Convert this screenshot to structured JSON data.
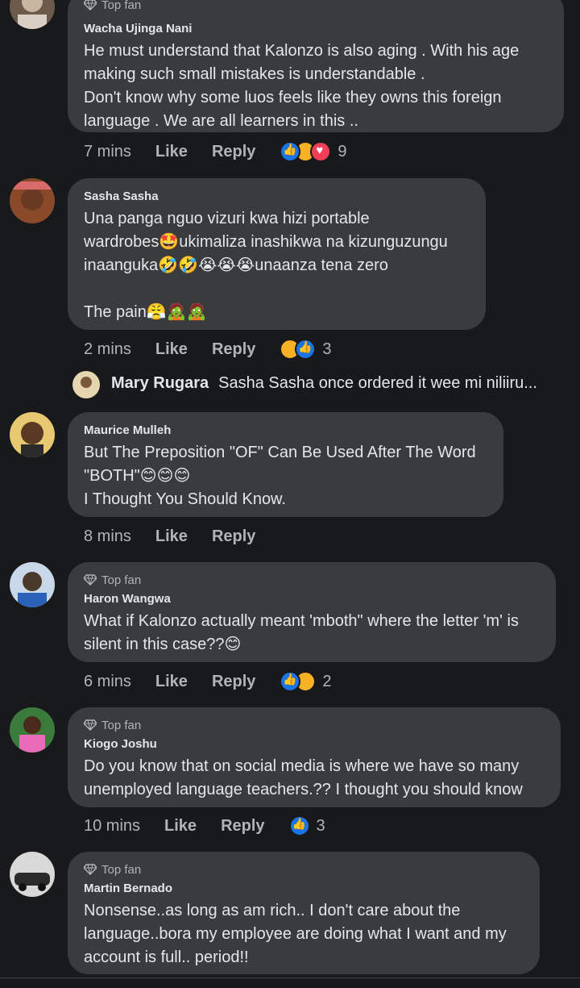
{
  "top_fan_label": "Top fan",
  "like_label": "Like",
  "reply_label": "Reply",
  "comments": [
    {
      "author": "Wacha Ujinga Nani",
      "top_fan": true,
      "text": "He must understand that Kalonzo is also aging  .  With his age\nmaking such small mistakes is understandable .\nDon't know why some luos feels like they owns this foreign\nlanguage . We are all learners in this ..",
      "time": "7 mins",
      "reactions": [
        "like",
        "haha",
        "love"
      ],
      "reaction_count": "9"
    },
    {
      "author": "Sasha Sasha",
      "top_fan": false,
      "text": "Una panga nguo vizuri kwa hizi portable\nwardrobes🤩ukimaliza inashikwa na kizunguzungu\ninaanguka🤣🤣😭😭😭unaanza tena zero\n\nThe pain😤🧟🧟",
      "time": "2 mins",
      "reactions": [
        "haha",
        "like"
      ],
      "reaction_count": "3",
      "reply": {
        "author": "Mary Rugara",
        "snippet": "Sasha Sasha once ordered it wee mi niliiru..."
      }
    },
    {
      "author": "Maurice Mulleh",
      "top_fan": false,
      "text": "But The Preposition \"OF\" Can Be Used After The Word\n\"BOTH\"😊😊😊\nI Thought You Should Know.",
      "time": "8 mins",
      "reactions": [],
      "reaction_count": ""
    },
    {
      "author": "Haron Wangwa",
      "top_fan": true,
      "text": "What if Kalonzo actually meant 'mboth\" where the letter 'm' is\nsilent in this case??😊",
      "time": "6 mins",
      "reactions": [
        "like",
        "haha"
      ],
      "reaction_count": "2"
    },
    {
      "author": "Kiogo Joshu",
      "top_fan": true,
      "text": "Do you know that on social media is where we have so many\nunemployed language teachers.?? I thought you should know",
      "time": "10 mins",
      "reactions": [
        "like"
      ],
      "reaction_count": "3"
    },
    {
      "author": "Martin Bernado",
      "top_fan": true,
      "text": "Nonsense..as long as am rich.. I don't care about the\nlanguage..bora my employee are doing what I want and my\naccount is full.. period!!",
      "time": "",
      "reactions": [],
      "reaction_count": ""
    }
  ],
  "colors": {
    "background": "#18191a",
    "bubble": "#3a3b3c",
    "text": "#e4e6eb",
    "secondary": "#b0b3b8",
    "like_blue": "#1b74e4",
    "haha_yellow": "#f7b125",
    "love_red": "#f33e58"
  }
}
